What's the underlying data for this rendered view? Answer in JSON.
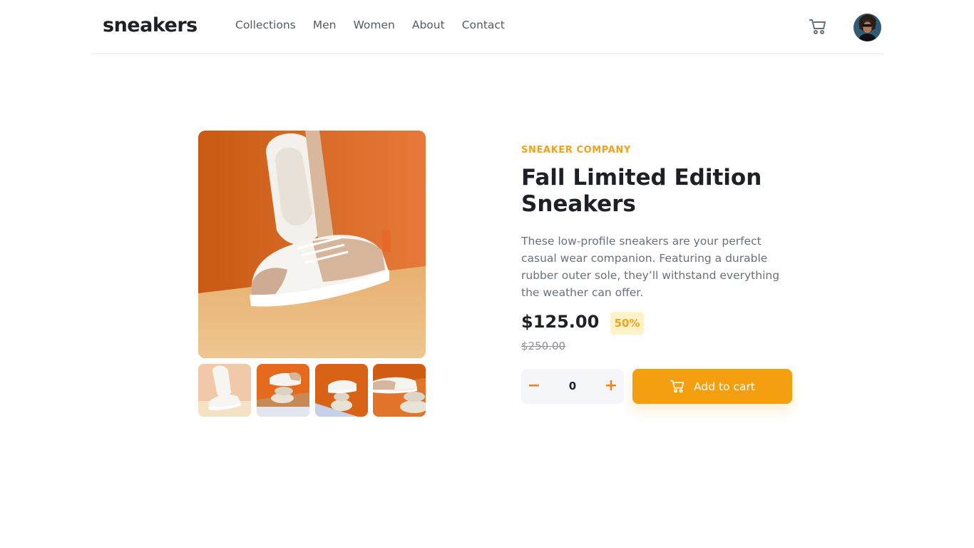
{
  "brand": {
    "logo": "sneakers"
  },
  "nav": {
    "items": [
      "Collections",
      "Men",
      "Women",
      "About",
      "Contact"
    ]
  },
  "header": {
    "cart_icon": "cart-icon",
    "avatar": "user-avatar"
  },
  "product": {
    "company": "SNEAKER COMPANY",
    "title": "Fall Limited Edition Sneakers",
    "description": "These low-profile sneakers are your perfect casual wear companion. Featuring a durable rubber outer sole, they’ll withstand everything the weather can offer.",
    "price": "$125.00",
    "discount": "50%",
    "original_price": "$250.00"
  },
  "gallery": {
    "thumbnails": [
      "product-1",
      "product-2",
      "product-3",
      "product-4"
    ],
    "selected_index": 0
  },
  "cart_controls": {
    "minus": "−",
    "quantity": "0",
    "plus": "+",
    "add_label": "Add to cart"
  },
  "colors": {
    "accent": "#f49f10",
    "accent_text": "#f2a11c",
    "discount_bg": "#fff1c8",
    "dark": "#1d2026",
    "muted": "#68707d"
  }
}
